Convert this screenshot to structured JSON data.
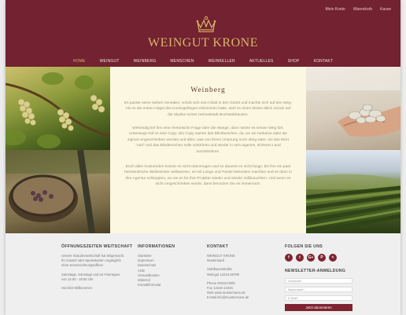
{
  "header": {
    "top_links": [
      "Mein Konto",
      "Warenkorb",
      "Kasse"
    ],
    "logo": "WEINGUT KRONE",
    "nav": [
      "HOME",
      "WEINGUT",
      "WEINBERG",
      "MENSCHEN",
      "WEINKELLER",
      "AKTUELLES",
      "SHOP",
      "KONTAKT"
    ],
    "active_nav": "HOME",
    "brand_color": "#722230",
    "gold": "#d8b56a"
  },
  "content": {
    "title": "Weinberg",
    "paragraphs": [
      "Es packte seine sieben Versalien, schob sich sein Initial in den Gürtel und machte sich auf den Weg. Als es die ersten Hügel des Kursivgebirges erklommen hatte, warf es einen letzten Blick zurück auf die Skyline seiner Heimatstadt Buchstabhausen.",
      "Wehmütig lief ihm eine rhetorische Frage über die Wange, dann setzte es seinen Weg fort. Unterwegs traf es eine Copy. Die Copy warnte das Blindtextchen, da, wo sie herkäme wäre sie zigmal umgeschrieben worden und alles, was von ihrem Ursprung noch übrig wäre, sei das Wort \"und\" und das Blindtextchen solle umkehren und wieder in sein eigenes, sicheres Land zurückkehren.",
      "Doch alles Gutzureden konnte es nicht überzeugen und so dauerte es nicht lange, bis ihm ein paar heimtückische Werbetexter auflauerten, es mit Longe und Parole betrunken machten und es dann in ihre Agentur schleppten, wo sie es für ihre Projekte wieder und wieder mißbrauchten. Und wenn es nicht umgeschrieben wurde, dann benutzen Sie es immernoch."
    ]
  },
  "footer": {
    "col1": {
      "heading": "ÖFFNUNGSZEITEN WEITSCHAFT",
      "lines": [
        "Unsere Straußenwirtschaft hat teilgemacht.",
        "Ihr Zusatzl oder Speisekarten zugänglich",
        "ohne Kennzeichnungsoffnen",
        "",
        "Samstage, Sonntage und an Feiertagen",
        "von 14:00 - 18:00 Uhr",
        "",
        "Herzlich Willkommen"
      ]
    },
    "col2": {
      "heading": "INFORMATIONEN",
      "links": [
        "Startseite",
        "Impressum",
        "Datenschutz",
        "AGB",
        "Versandkosten",
        "Widerruf",
        "Kontaktformular"
      ]
    },
    "col3": {
      "heading": "KONTAKT",
      "lines": [
        "WEINGUT KRONE",
        "Musterstadt",
        "",
        "Stahlbaumstraße",
        "Weingut 12234 66788",
        "",
        "Phone 00492-0000",
        "Fax 12246-12345",
        "Web www.mustermann.de",
        "E-Mail info@mustermann.de"
      ]
    },
    "col4": {
      "social_heading": "FOLGEN SIE UNS",
      "social_icons": [
        "facebook-icon",
        "twitter-icon",
        "google-plus-icon",
        "pinterest-icon",
        "share-icon"
      ],
      "social_glyphs": [
        "f",
        "t",
        "G+",
        "P",
        "<"
      ],
      "newsletter_heading": "NEWSLETTER-ANMELDUNG",
      "name_placeholder": "Vorname*",
      "surname_placeholder": "Nachname*",
      "email_placeholder": "E-Mail*",
      "button": "Jetzt abonnieren"
    }
  }
}
